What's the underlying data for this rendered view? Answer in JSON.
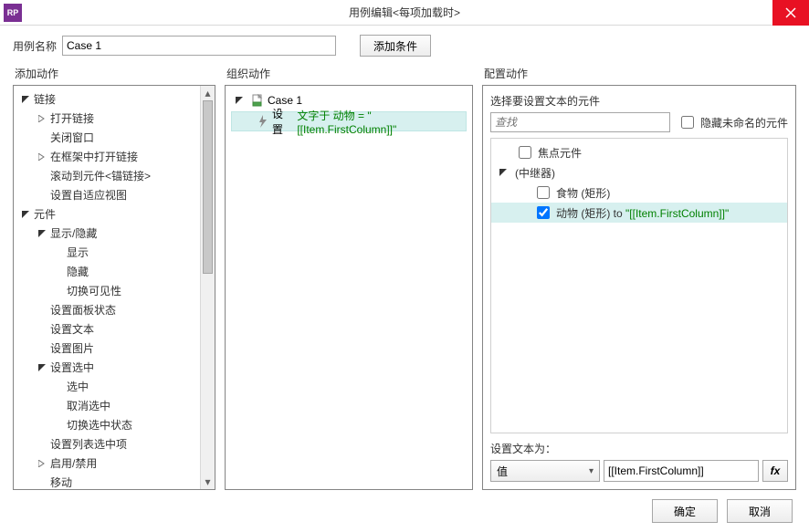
{
  "titlebar": {
    "app": "RP",
    "title": "用例编辑<每项加载时>"
  },
  "name_row": {
    "label": "用例名称",
    "value": "Case 1",
    "add_condition": "添加条件"
  },
  "panel_titles": {
    "left": "添加动作",
    "mid": "组织动作",
    "right": "配置动作"
  },
  "left_tree": {
    "link": "链接",
    "open_link": "打开链接",
    "close_window": "关闭窗口",
    "open_in_frame": "在框架中打开链接",
    "scroll_to": "滚动到元件<锚链接>",
    "set_adaptive": "设置自适应视图",
    "widget": "元件",
    "show_hide": "显示/隐藏",
    "show": "显示",
    "hide": "隐藏",
    "toggle_vis": "切换可见性",
    "set_panel_state": "设置面板状态",
    "set_text": "设置文本",
    "set_image": "设置图片",
    "set_selected": "设置选中",
    "selected": "选中",
    "unselect": "取消选中",
    "toggle_selected": "切换选中状态",
    "set_list_item": "设置列表选中项",
    "enable_disable": "启用/禁用",
    "move": "移动"
  },
  "mid": {
    "case_name": "Case 1",
    "action_prefix": "设置 ",
    "action_green": "文字于 动物 = \"[[Item.FirstColumn]]\""
  },
  "right": {
    "header": "选择要设置文本的元件",
    "search_placeholder": "查找",
    "hide_unnamed": "隐藏未命名的元件",
    "focus_widget": "焦点元件",
    "repeater": "(中继器)",
    "food": "食物 (矩形)",
    "animal_pre": "动物 (矩形) to ",
    "animal_green": "\"[[Item.FirstColumn]]\"",
    "set_text_to": "设置文本为：",
    "select_value": "值",
    "input_value": "[[Item.FirstColumn]]",
    "fx": "fx"
  },
  "footer": {
    "ok": "确定",
    "cancel": "取消"
  }
}
